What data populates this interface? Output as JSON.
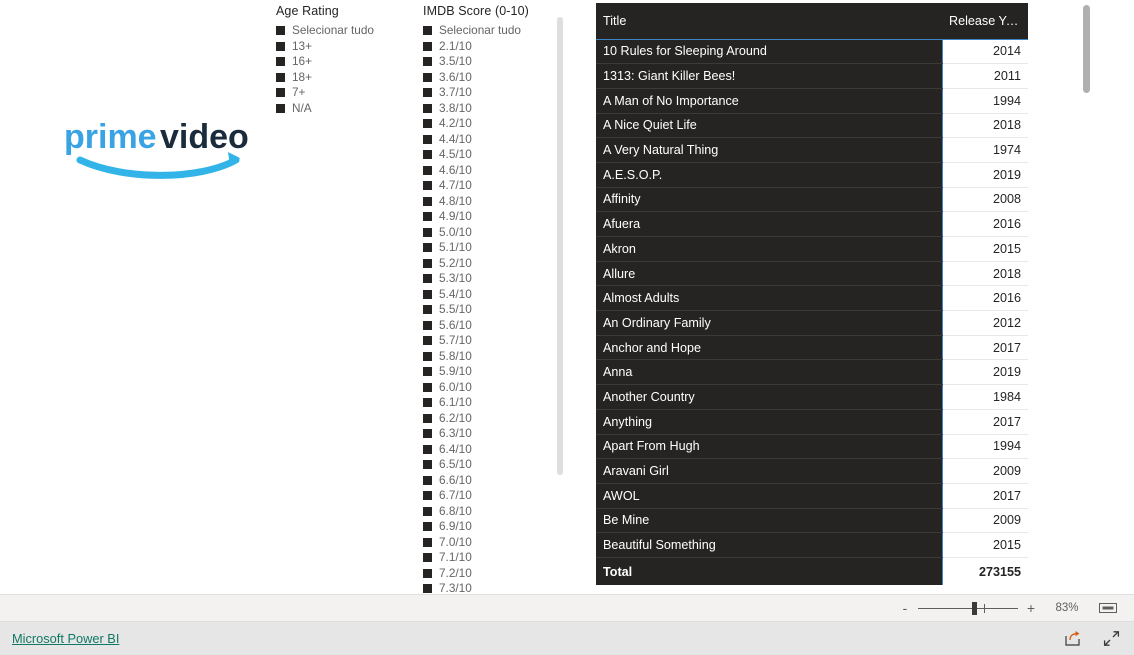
{
  "report": {
    "logo": {
      "name": "prime-video-logo",
      "word1": "prime",
      "word2": "video",
      "color_word1": "#3aa3e3",
      "color_word2": "#1a2b3c",
      "color_smile": "#32b4e8"
    },
    "slicers": [
      {
        "id": "age-rating",
        "title": "Age Rating",
        "items": [
          {
            "label": "Selecionar tudo"
          },
          {
            "label": "13+"
          },
          {
            "label": "16+"
          },
          {
            "label": "18+"
          },
          {
            "label": "7+"
          },
          {
            "label": "N/A"
          }
        ]
      },
      {
        "id": "imdb-score",
        "title": "IMDB Score (0-10)",
        "items": [
          {
            "label": "Selecionar tudo"
          },
          {
            "label": "2.1/10"
          },
          {
            "label": "3.5/10"
          },
          {
            "label": "3.6/10"
          },
          {
            "label": "3.7/10"
          },
          {
            "label": "3.8/10"
          },
          {
            "label": "4.2/10"
          },
          {
            "label": "4.4/10"
          },
          {
            "label": "4.5/10"
          },
          {
            "label": "4.6/10"
          },
          {
            "label": "4.7/10"
          },
          {
            "label": "4.8/10"
          },
          {
            "label": "4.9/10"
          },
          {
            "label": "5.0/10"
          },
          {
            "label": "5.1/10"
          },
          {
            "label": "5.2/10"
          },
          {
            "label": "5.3/10"
          },
          {
            "label": "5.4/10"
          },
          {
            "label": "5.5/10"
          },
          {
            "label": "5.6/10"
          },
          {
            "label": "5.7/10"
          },
          {
            "label": "5.8/10"
          },
          {
            "label": "5.9/10"
          },
          {
            "label": "6.0/10"
          },
          {
            "label": "6.1/10"
          },
          {
            "label": "6.2/10"
          },
          {
            "label": "6.3/10"
          },
          {
            "label": "6.4/10"
          },
          {
            "label": "6.5/10"
          },
          {
            "label": "6.6/10"
          },
          {
            "label": "6.7/10"
          },
          {
            "label": "6.8/10"
          },
          {
            "label": "6.9/10"
          },
          {
            "label": "7.0/10"
          },
          {
            "label": "7.1/10"
          },
          {
            "label": "7.2/10"
          },
          {
            "label": "7.3/10"
          }
        ]
      }
    ],
    "table": {
      "columns": [
        "Title",
        "Release Year"
      ],
      "rows": [
        [
          "10 Rules for Sleeping Around",
          "2014"
        ],
        [
          "1313: Giant Killer Bees!",
          "2011"
        ],
        [
          "A Man of No Importance",
          "1994"
        ],
        [
          "A Nice Quiet Life",
          "2018"
        ],
        [
          "A Very Natural Thing",
          "1974"
        ],
        [
          "A.E.S.O.P.",
          "2019"
        ],
        [
          "Affinity",
          "2008"
        ],
        [
          "Afuera",
          "2016"
        ],
        [
          "Akron",
          "2015"
        ],
        [
          "Allure",
          "2018"
        ],
        [
          "Almost Adults",
          "2016"
        ],
        [
          "An Ordinary Family",
          "2012"
        ],
        [
          "Anchor and Hope",
          "2017"
        ],
        [
          "Anna",
          "2019"
        ],
        [
          "Another Country",
          "1984"
        ],
        [
          "Anything",
          "2017"
        ],
        [
          "Apart From Hugh",
          "1994"
        ],
        [
          "Aravani Girl",
          "2009"
        ],
        [
          "AWOL",
          "2017"
        ],
        [
          "Be Mine",
          "2009"
        ],
        [
          "Beautiful Something",
          "2015"
        ]
      ],
      "total_label": "Total",
      "total_value": "273155",
      "accent_color": "#3d85c6",
      "header_bg": "#252423"
    }
  },
  "toolbar": {
    "zoom_out_label": "-",
    "zoom_in_label": "+",
    "zoom_value": "83%",
    "fit_icon": "fit-to-page-icon"
  },
  "footer": {
    "brand_link": "Microsoft Power BI",
    "brand_link_color": "#117865",
    "share_icon": "share-icon",
    "fullscreen_icon": "fullscreen-icon"
  }
}
